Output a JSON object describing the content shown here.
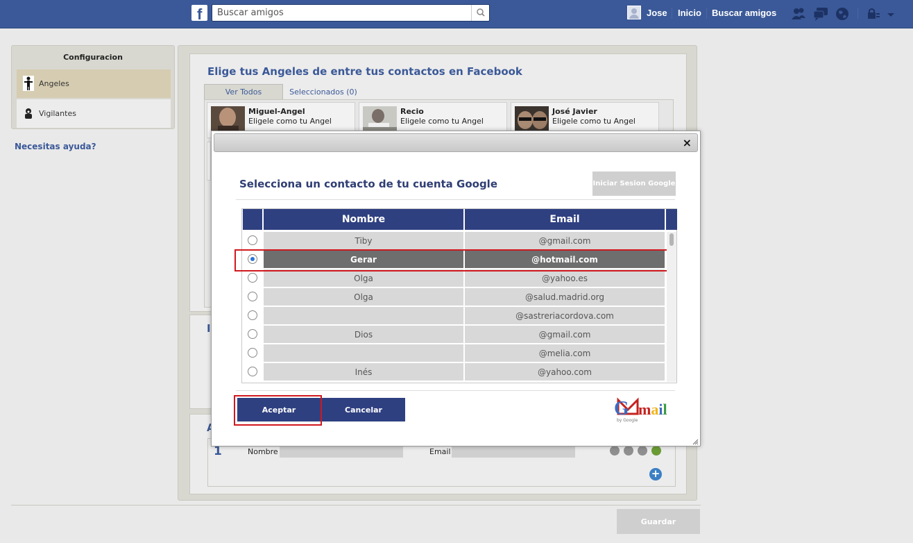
{
  "topbar": {
    "search_placeholder": "Buscar amigos",
    "user_name": "Jose",
    "home_label": "Inicio",
    "find_friends_label": "Buscar amigos"
  },
  "sidebar": {
    "title": "Configuracion",
    "items": [
      {
        "label": "Angeles",
        "icon": "angel-icon",
        "active": true
      },
      {
        "label": "Vigilantes",
        "icon": "vigilante-icon",
        "active": false
      }
    ],
    "help_label": "Necesitas ayuda?"
  },
  "main": {
    "title": "Elige tus Angeles de entre tus contactos en Facebook",
    "tabs": [
      {
        "label": "Ver Todos",
        "active": true
      },
      {
        "label": "Seleccionados (0)",
        "active": false
      }
    ],
    "cards": [
      {
        "name": "Miguel-Angel",
        "subtitle": "Eligele como tu Angel"
      },
      {
        "name": "Recio",
        "subtitle": "Eligele como tu Angel"
      },
      {
        "name": "José Javier",
        "subtitle": "Eligele como tu Angel"
      }
    ],
    "section2_letter": "I",
    "section3_letter": "A",
    "row": {
      "index": "1",
      "name_label": "Nombre",
      "email_label": "Email"
    },
    "save_label": "Guardar"
  },
  "modal": {
    "title": "Selecciona un contacto de tu cuenta Google",
    "google_login_label": "Iniciar Sesion Google",
    "close_label": "×",
    "columns": [
      "Nombre",
      "Email"
    ],
    "rows": [
      {
        "name": "Tiby",
        "email": "@gmail.com",
        "selected": false
      },
      {
        "name": "Gerar",
        "email": "@hotmail.com",
        "selected": true
      },
      {
        "name": "Olga",
        "email": "@yahoo.es",
        "selected": false
      },
      {
        "name": "Olga",
        "email": "@salud.madrid.org",
        "selected": false
      },
      {
        "name": "",
        "email": "@sastreriacordova.com",
        "selected": false
      },
      {
        "name": "Dios",
        "email": "@gmail.com",
        "selected": false
      },
      {
        "name": "",
        "email": "@melia.com",
        "selected": false
      },
      {
        "name": "Inés",
        "email": "@yahoo.com",
        "selected": false
      }
    ],
    "accept_label": "Aceptar",
    "cancel_label": "Cancelar",
    "gmail_logo": {
      "word": "Gmail",
      "by": "by Google"
    }
  },
  "colors": {
    "facebook_blue": "#3b5998",
    "header_blue": "#2f4081",
    "selected_row": "#6e6e6e",
    "highlight_red": "#d0181e"
  }
}
